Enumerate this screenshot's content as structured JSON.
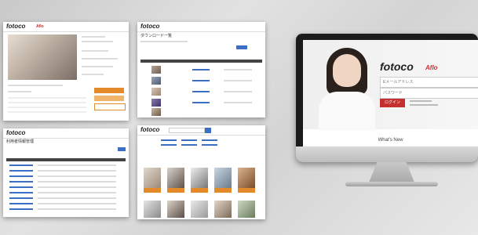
{
  "screenshots": {
    "top_left": {
      "logo": "fotoco"
    },
    "top_right": {
      "logo": "fotoco",
      "title": "ダウンロード一覧"
    },
    "bottom_left": {
      "logo": "fotoco",
      "title": "利用者情報管理"
    },
    "bottom_right": {
      "logo": "fotoco"
    }
  },
  "monitor": {
    "logo": "fotoco",
    "email_placeholder": "Eメールアドレス",
    "password_placeholder": "パスワード",
    "login_button": "ログイン",
    "whats_new": "What's New"
  },
  "colors": {
    "accent_orange": "#e58a2b",
    "login_red": "#c62f2f",
    "link_blue": "#3a6fc4"
  }
}
